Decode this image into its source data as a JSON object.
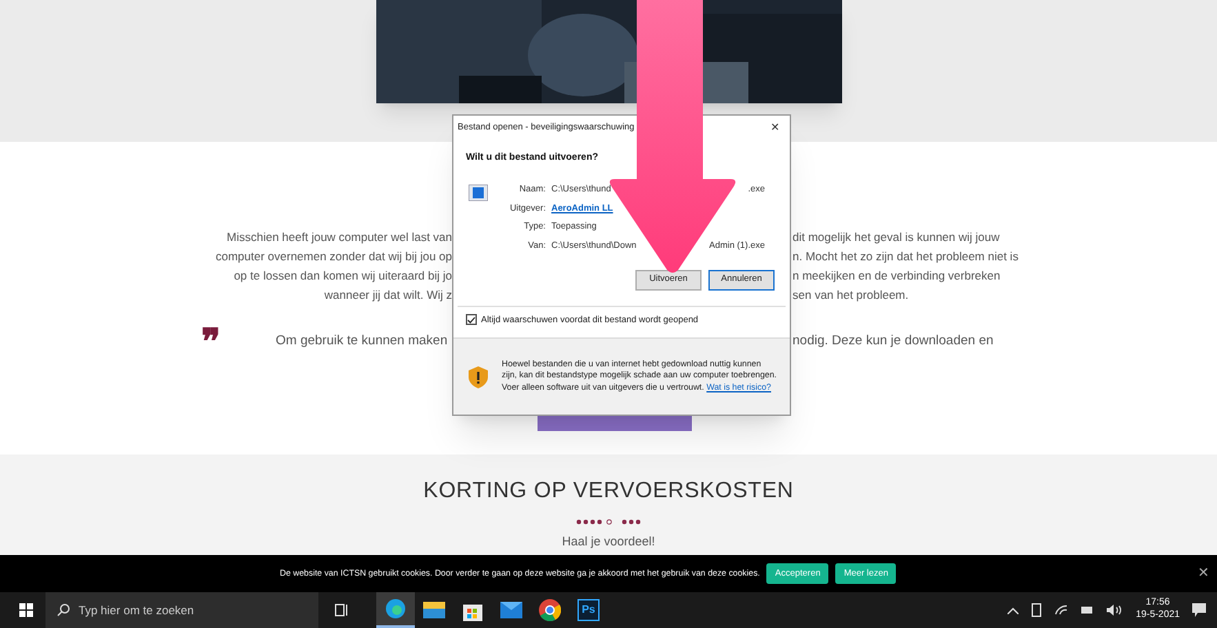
{
  "page": {
    "paragraph_lines": [
      {
        "left": "Misschien heeft jouw computer wel last van",
        "right": "dit mogelijk het geval is kunnen wij jouw"
      },
      {
        "left": "computer overnemen zonder dat wij bij jou op",
        "right": "n. Mocht het zo zijn dat het probleem niet is"
      },
      {
        "left": "op te lossen dan komen wij uiteraard bij jo",
        "right": "n meekijken en de verbinding verbreken"
      },
      {
        "left": "wanneer jij dat wilt. Wij z",
        "right": "sen van het probleem."
      }
    ],
    "quote_mark": "❞",
    "quote_line": {
      "left": "Om gebruik te kunnen maken",
      "right": "nodig. Deze kun je downloaden en"
    },
    "section_title": "KORTING OP VERVOERSKOSTEN",
    "section_subtitle": "Haal je voordeel!"
  },
  "dialog": {
    "title": "Bestand openen - beveiligingswaarschuwing",
    "heading": "Wilt u dit bestand uitvoeren?",
    "fields": [
      {
        "label": "Naam:",
        "value_start": "C:\\Users\\thund",
        "value_end": ".exe",
        "kind": "text"
      },
      {
        "label": "Uitgever:",
        "value_start": "AeroAdmin LL",
        "kind": "link"
      },
      {
        "label": "Type:",
        "value_start": "Toepassing",
        "kind": "text"
      },
      {
        "label": "Van:",
        "value_start": "C:\\Users\\thund\\Down",
        "value_end": "Admin (1).exe",
        "kind": "text"
      }
    ],
    "buttons": [
      {
        "label": "Uitvoeren",
        "selected": false
      },
      {
        "label": "Annuleren",
        "selected": true
      }
    ],
    "checkbox": {
      "label": "Altijd waarschuwen voordat dit bestand wordt geopend",
      "checked": true
    },
    "warning": "Hoewel bestanden die u van internet hebt gedownload nuttig kunnen zijn, kan dit bestandstype mogelijk schade aan uw computer toebrengen. Voer alleen software uit van uitgevers die u vertrouwt.",
    "warning_link": "Wat is het risico?",
    "close": "✕"
  },
  "cookie_bar": {
    "text": "De website van ICTSN gebruikt cookies. Door verder te gaan op deze website ga je akkoord met het gebruik van deze cookies.",
    "buttons": [
      "Accepteren",
      "Meer lezen"
    ],
    "close": "✕"
  },
  "taskbar": {
    "search_placeholder": "Typ hier om te zoeken",
    "apps": [
      {
        "kind": "edge",
        "selected": true
      },
      {
        "kind": "files",
        "selected": false
      },
      {
        "kind": "store",
        "selected": false
      },
      {
        "kind": "mail",
        "selected": false
      },
      {
        "kind": "chrome",
        "selected": false
      },
      {
        "kind": "photoshop",
        "label": "Ps",
        "selected": false
      }
    ],
    "time": "17:56",
    "date": "19-5-2021"
  }
}
